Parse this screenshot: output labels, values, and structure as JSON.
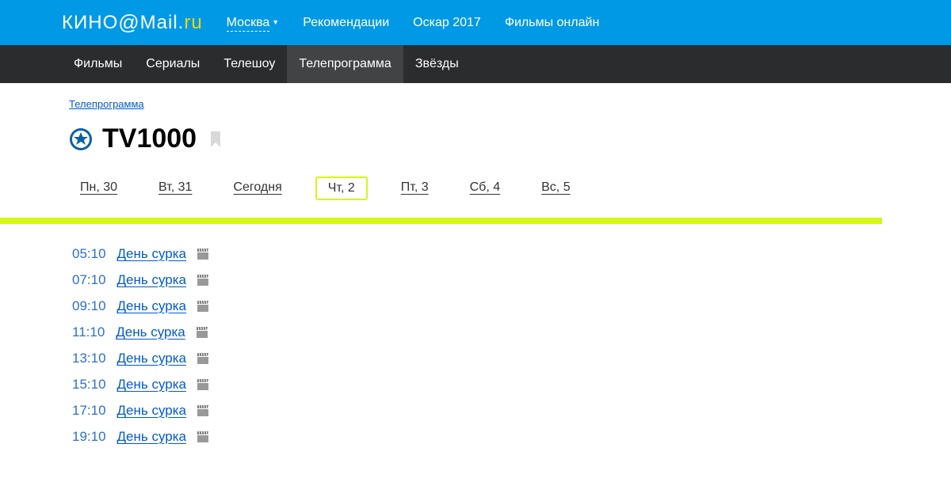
{
  "logo": {
    "kino": "КИНО",
    "at": "@",
    "mail": "Mail",
    "dot": ".",
    "ru": "ru"
  },
  "top_links": {
    "city": "Москва",
    "recommendations": "Рекомендации",
    "oscar": "Оскар 2017",
    "films_online": "Фильмы онлайн"
  },
  "nav": {
    "films": "Фильмы",
    "series": "Сериалы",
    "shows": "Телешоу",
    "schedule": "Телепрограмма",
    "stars": "Звёзды"
  },
  "breadcrumb": "Телепрограмма",
  "channel": {
    "name": "TV1000"
  },
  "days": [
    {
      "label": "Пн, 30"
    },
    {
      "label": "Вт, 31"
    },
    {
      "label": "Сегодня"
    },
    {
      "label": "Чт, 2"
    },
    {
      "label": "Пт, 3"
    },
    {
      "label": "Сб, 4"
    },
    {
      "label": "Вс, 5"
    }
  ],
  "schedule": [
    {
      "time": "05:10",
      "title": "День сурка"
    },
    {
      "time": "07:10",
      "title": "День сурка"
    },
    {
      "time": "09:10",
      "title": "День сурка"
    },
    {
      "time": "11:10",
      "title": "День сурка"
    },
    {
      "time": "13:10",
      "title": "День сурка"
    },
    {
      "time": "15:10",
      "title": "День сурка"
    },
    {
      "time": "17:10",
      "title": "День сурка"
    },
    {
      "time": "19:10",
      "title": "День сурка"
    }
  ]
}
